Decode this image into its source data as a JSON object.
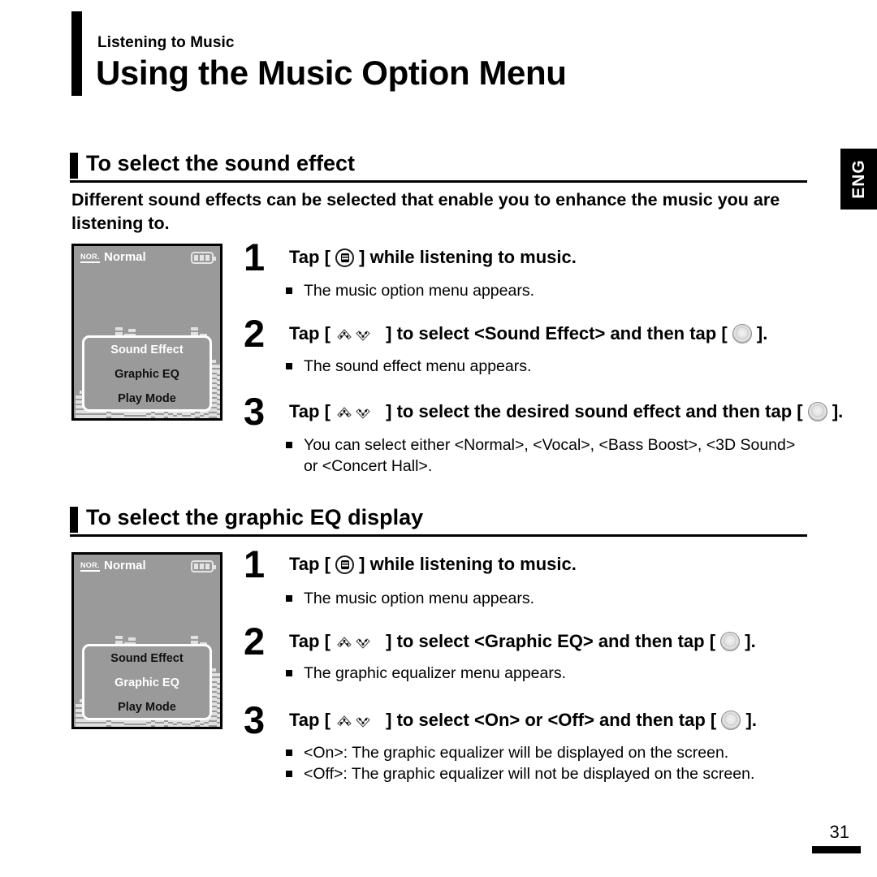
{
  "header": {
    "kicker": "Listening to Music",
    "title": "Using the Music Option Menu"
  },
  "language_tab": {
    "label": "ENG"
  },
  "footer": {
    "page_number": "31"
  },
  "icons": {
    "menu": "menu-button-icon",
    "select": "select-button-icon",
    "updown": "up-down-navigation-icon",
    "battery": "battery-icon"
  },
  "sections": [
    {
      "id": "sound-effect",
      "heading": "To select the sound effect",
      "intro": "Different sound effects can be selected that enable you to enhance the music you are listening to.",
      "lcd": {
        "status_badge": "NOR.",
        "mode_label": "Normal",
        "battery_bars": 3,
        "menu_items": [
          {
            "label": "Sound Effect",
            "selected": true
          },
          {
            "label": "Graphic EQ",
            "selected": false
          },
          {
            "label": "Play Mode",
            "selected": false
          }
        ]
      },
      "steps": [
        {
          "number": "1",
          "text_before": "Tap [",
          "icon": "menu",
          "text_after": "] while listening to music.",
          "notes": [
            "The music option menu appears."
          ]
        },
        {
          "number": "2",
          "text_before": "Tap [",
          "icon": "updown",
          "text_mid": "] to select <Sound Effect> and then tap [",
          "icon2": "select",
          "text_after": "].",
          "notes": [
            "The sound effect menu appears."
          ]
        },
        {
          "number": "3",
          "text_before": "Tap [",
          "icon": "updown",
          "text_mid": "] to select the desired sound effect and then tap [",
          "icon2": "select",
          "text_after": "].",
          "notes": [
            "You can select either <Normal>, <Vocal>, <Bass Boost>, <3D Sound>",
            "or <Concert Hall>."
          ]
        }
      ]
    },
    {
      "id": "graphic-eq",
      "heading": "To select the graphic EQ display",
      "lcd": {
        "status_badge": "NOR.",
        "mode_label": "Normal",
        "battery_bars": 3,
        "menu_items": [
          {
            "label": "Sound Effect",
            "selected": false
          },
          {
            "label": "Graphic EQ",
            "selected": true
          },
          {
            "label": "Play Mode",
            "selected": false
          }
        ]
      },
      "steps": [
        {
          "number": "1",
          "text_before": "Tap [",
          "icon": "menu",
          "text_after": "] while listening to music.",
          "notes": [
            "The music option menu appears."
          ]
        },
        {
          "number": "2",
          "text_before": "Tap [",
          "icon": "updown",
          "text_mid": "] to select <Graphic EQ> and then tap [",
          "icon2": "select",
          "text_after": "].",
          "notes": [
            "The graphic equalizer menu appears."
          ]
        },
        {
          "number": "3",
          "text_before": "Tap [",
          "icon": "updown",
          "text_mid": "] to select <On> or <Off> and then tap [",
          "icon2": "select",
          "text_after": "].",
          "notes": [
            "<On>: The graphic equalizer will be displayed on the screen.",
            "<Off>: The graphic equalizer will not be displayed on the screen."
          ]
        }
      ]
    }
  ],
  "eq_bar_heights": [
    28,
    34,
    40,
    58,
    70,
    82,
    88,
    84,
    94,
    112,
    88,
    104,
    110,
    92,
    80,
    62,
    40,
    30,
    22,
    22,
    30,
    46,
    56,
    40,
    26,
    80,
    112,
    96,
    104,
    88,
    72,
    66,
    58,
    64
  ]
}
